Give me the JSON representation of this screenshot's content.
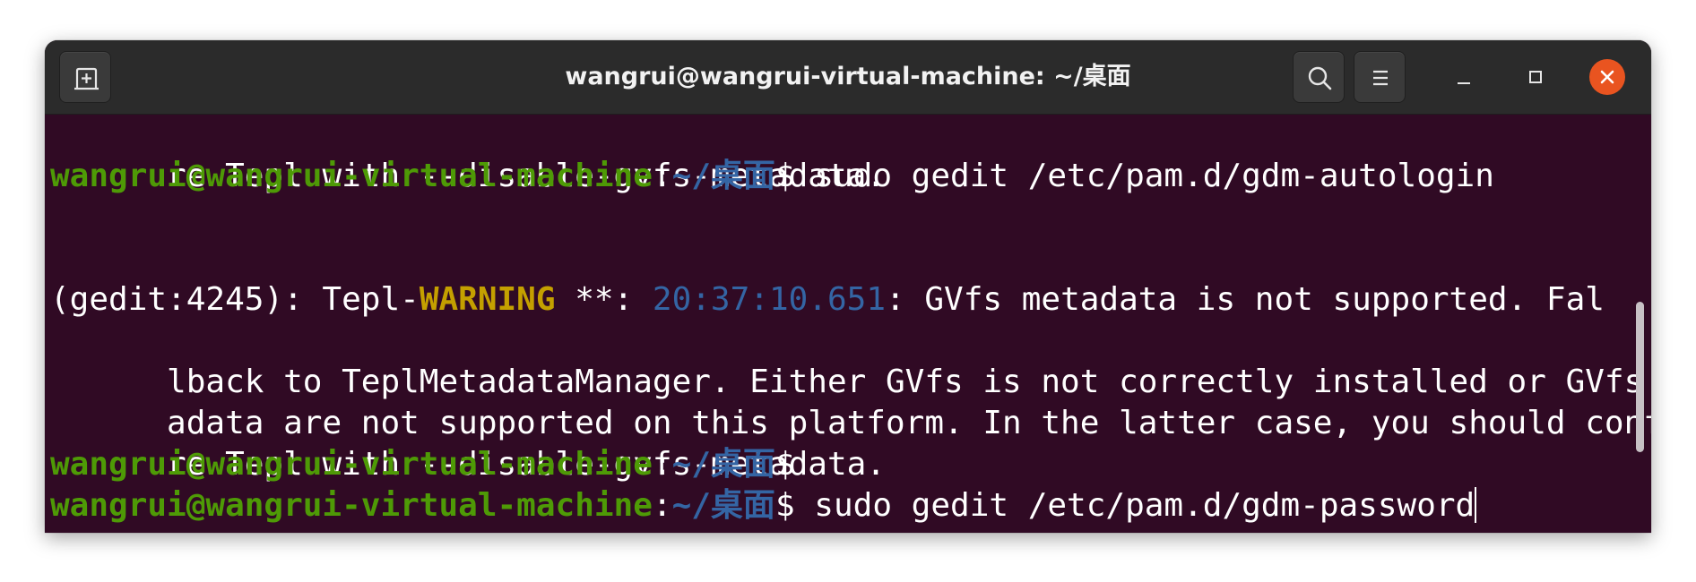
{
  "window": {
    "title": "wangrui@wangrui-virtual-machine: ~/桌面"
  },
  "icons": {
    "new_tab": "new-tab-icon",
    "search": "search-icon",
    "menu": "hamburger-menu-icon",
    "minimize": "minimize-icon",
    "maximize": "maximize-icon",
    "close": "close-icon"
  },
  "colors": {
    "terminal_bg": "#300a24",
    "titlebar_bg": "#2b2b2b",
    "user_host": "#4e9a06",
    "path": "#3465a4",
    "warning": "#c4a000",
    "timestamp": "#3465a4",
    "close_button": "#e95420"
  },
  "terminal": {
    "prompt_user": "wangrui@wangrui-virtual-machine",
    "prompt_sep": ":",
    "prompt_path": "~/桌面",
    "prompt_symbol": "$",
    "line1": "re Tepl with --disable-gvfs-metadata.",
    "cmd1": " sudo gedit /etc/pam.d/gdm-autologin",
    "warn_prefix": "(gedit:4245): Tepl-",
    "warn_word": "WARNING",
    "warn_mid": " **: ",
    "warn_time": "20:37:10.651",
    "warn_rest": ": GVfs metadata is not supported. Fal",
    "line5": "lback to TeplMetadataManager. Either GVfs is not correctly installed or GVfs met",
    "line6": "adata are not supported on this platform. In the latter case, you should configu",
    "line7": "re Tepl with --disable-gvfs-metadata.",
    "cmd3": " sudo gedit /etc/pam.d/gdm-password"
  }
}
